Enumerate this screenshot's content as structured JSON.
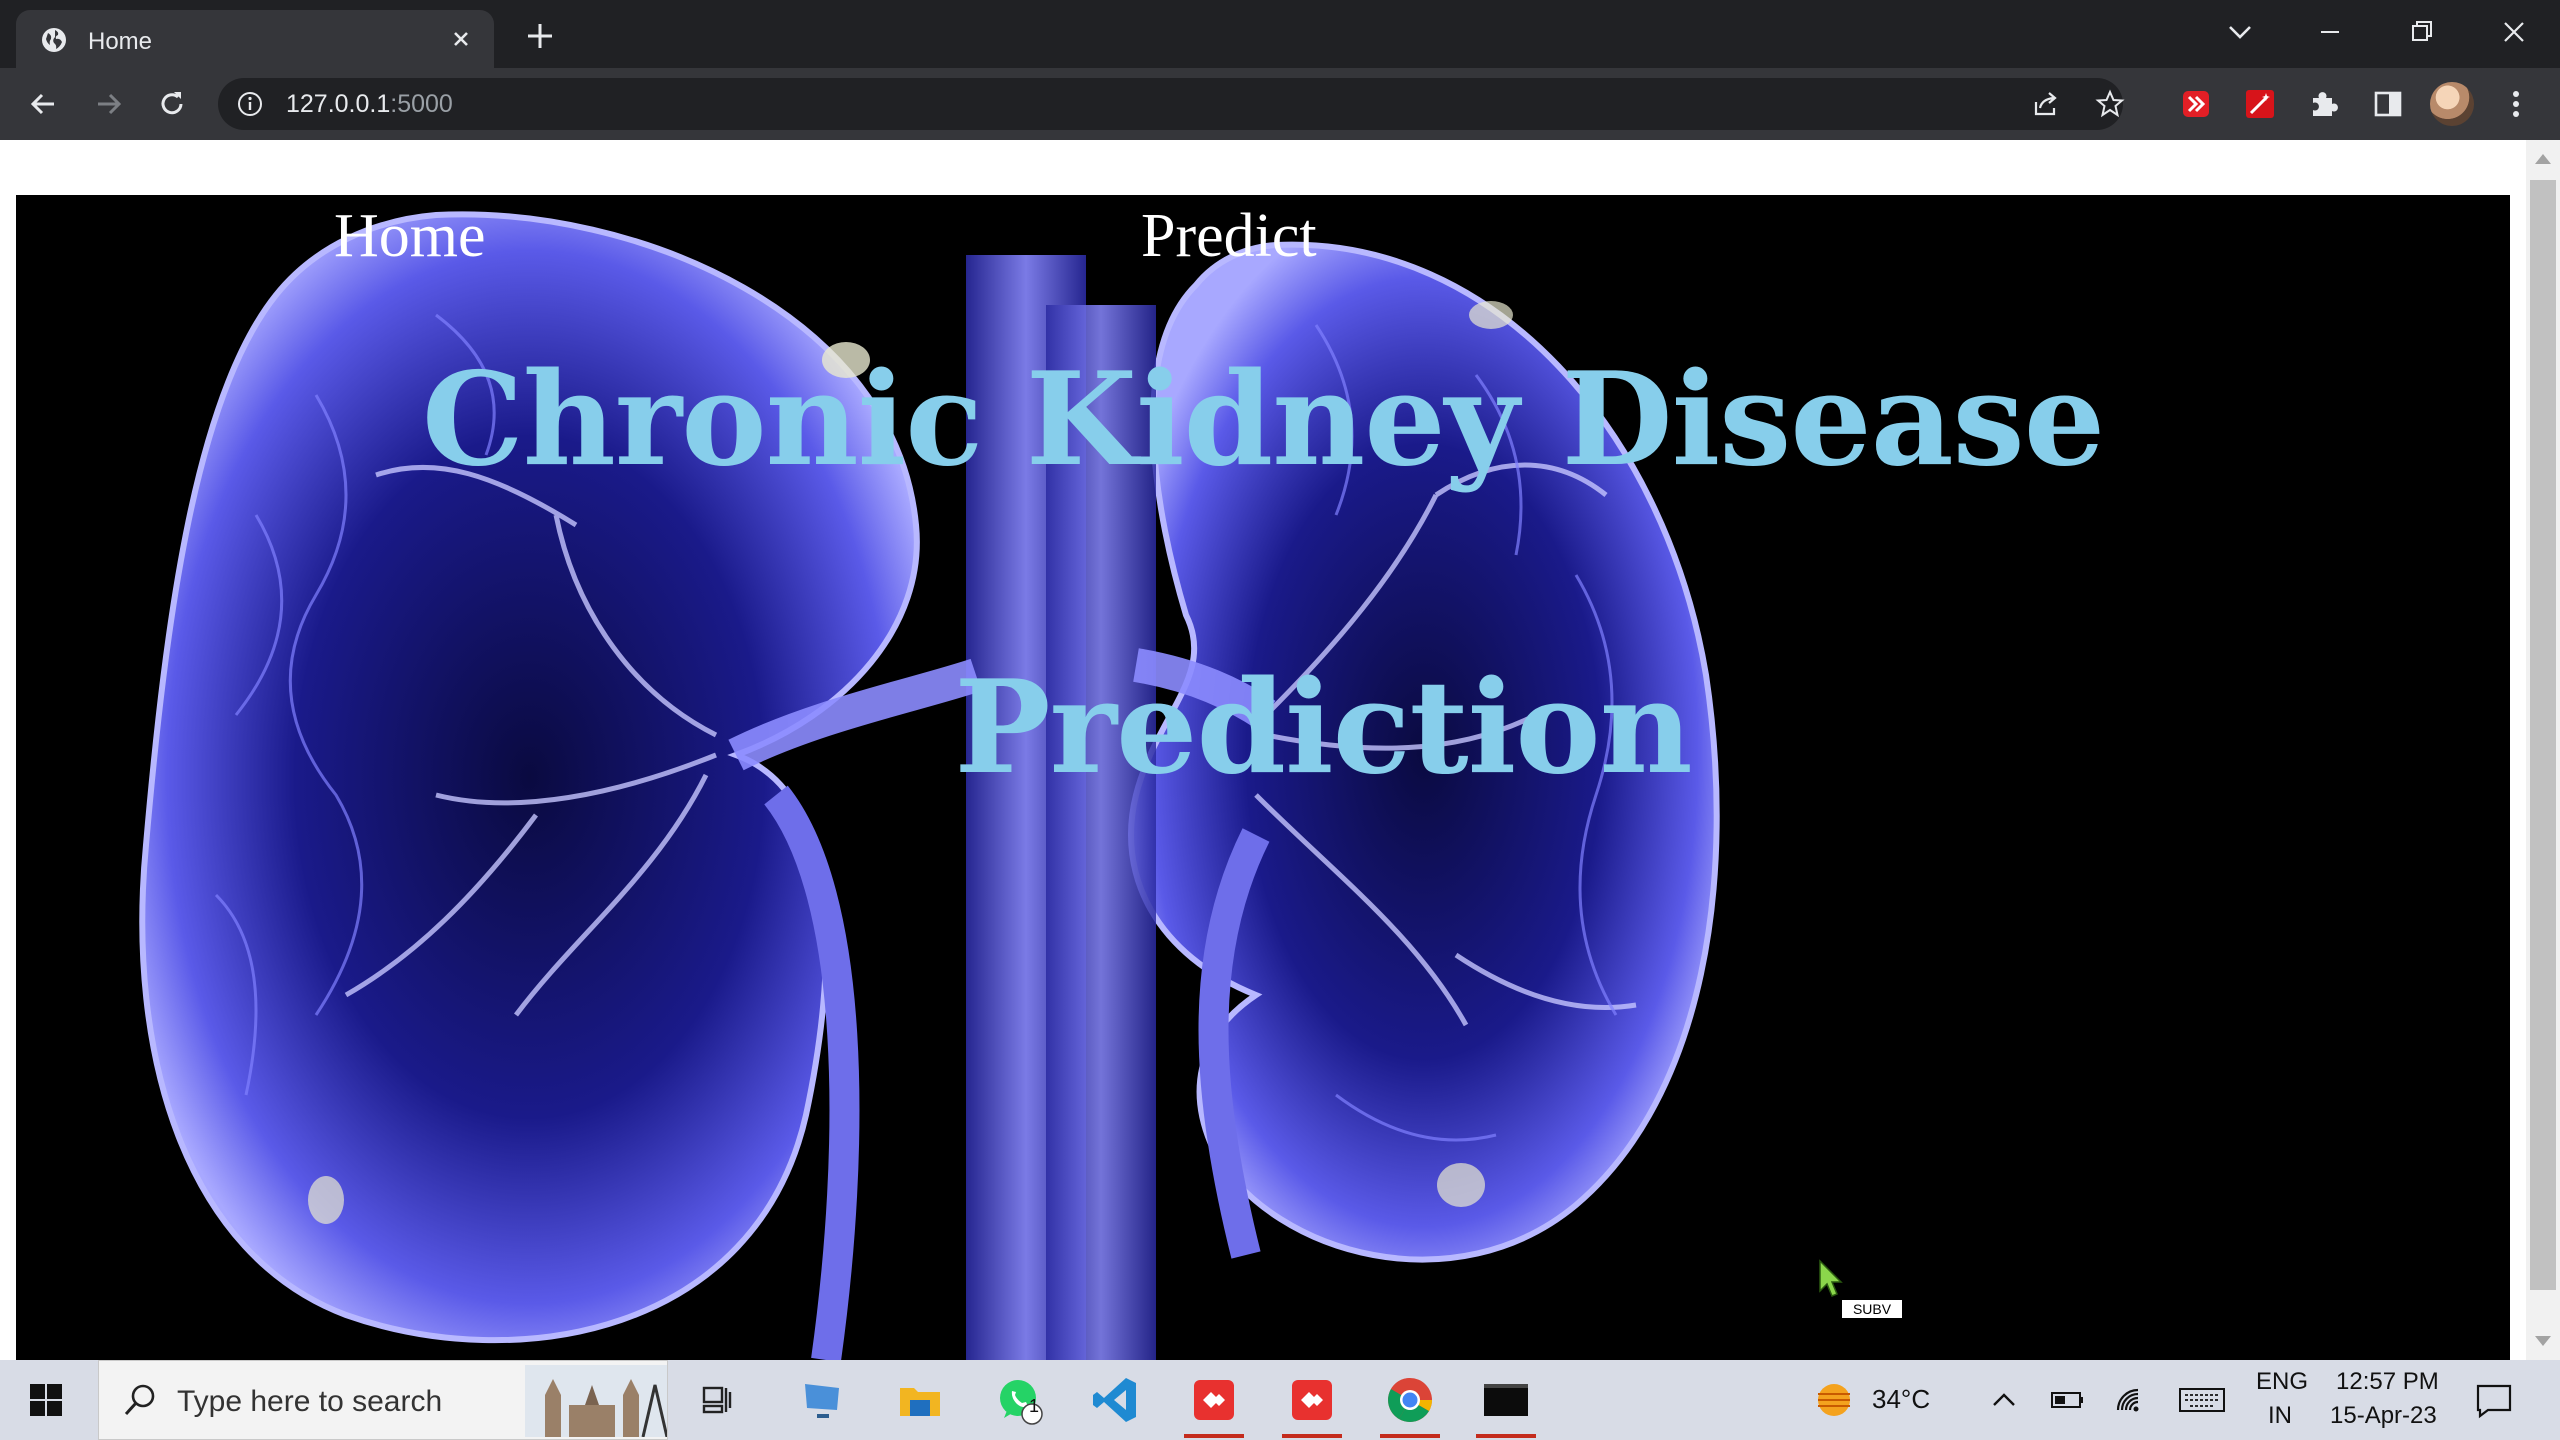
{
  "browser": {
    "tab_title": "Home",
    "url_host": "127.0.0.1",
    "url_port": ":5000"
  },
  "page": {
    "nav": {
      "home": "Home",
      "predict": "Predict"
    },
    "headline_line1": "Chronic Kidney Disease",
    "headline_line2": "Prediction",
    "partial_chip": "SUBV"
  },
  "taskbar": {
    "search_placeholder": "Type here to search",
    "whatsapp_badge": "1",
    "weather": "34°C",
    "language": "ENG",
    "region": "IN",
    "time": "12:57 PM",
    "date": "15-Apr-23"
  },
  "colors": {
    "headline": "#87ceeb",
    "page_bg": "#000000",
    "chrome_dark": "#202124",
    "chrome_toolbar": "#35363a"
  }
}
